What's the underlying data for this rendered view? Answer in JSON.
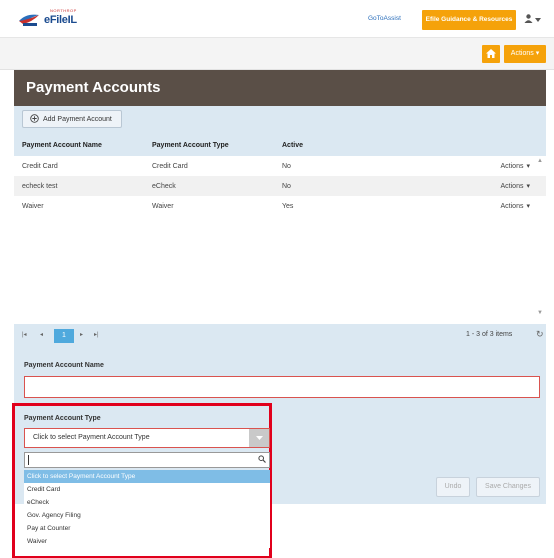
{
  "header": {
    "logo_small": "NORTHROP",
    "logo_text": "eFileIL",
    "gotoassist": "GoToAssist",
    "guidance": "Efile Guidance & Resources"
  },
  "subbar": {
    "actions_label": "Actions"
  },
  "panel": {
    "title": "Payment Accounts",
    "add_button": "Add Payment Account"
  },
  "grid": {
    "columns": [
      "Payment Account Name",
      "Payment Account Type",
      "Active"
    ],
    "rows": [
      {
        "name": "Credit Card",
        "type": "Credit Card",
        "active": "No",
        "actions": "Actions"
      },
      {
        "name": "echeck test",
        "type": "eCheck",
        "active": "No",
        "actions": "Actions"
      },
      {
        "name": "Waiver",
        "type": "Waiver",
        "active": "Yes",
        "actions": "Actions"
      }
    ]
  },
  "pager": {
    "current_page": "1",
    "info": "1 - 3 of 3 items"
  },
  "form": {
    "name_label": "Payment Account Name",
    "type_label": "Payment Account Type",
    "type_placeholder": "Click to select Payment Account Type",
    "options": [
      "Click to select Payment Account Type",
      "Credit Card",
      "eCheck",
      "Gov. Agency Filing",
      "Pay at Counter",
      "Waiver"
    ],
    "selected_option": "Click to select Payment Account Type",
    "undo": "Undo",
    "save": "Save Changes"
  },
  "colors": {
    "accent": "#f5a20a",
    "panel_header": "#5a4f47",
    "panel_body": "#dbe8f2",
    "highlight": "#e1001c",
    "link": "#2a6ebb"
  }
}
